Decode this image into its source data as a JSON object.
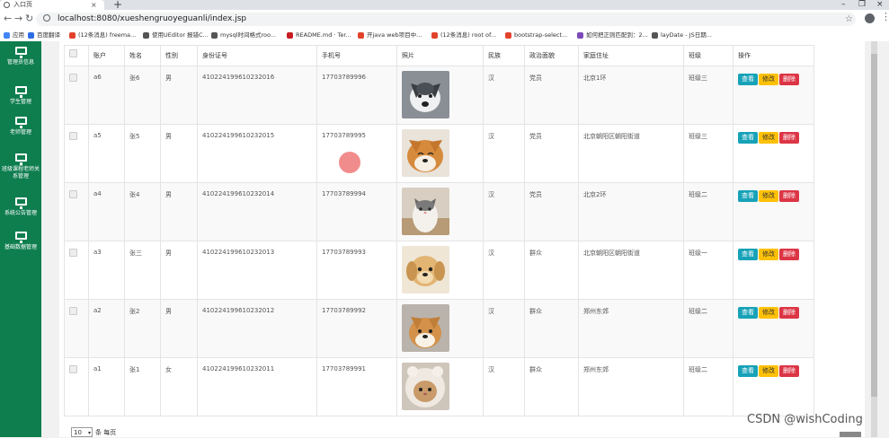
{
  "browser": {
    "tab_title": "入口页",
    "url": "localhost:8080/xueshengruoyeguanli/index.jsp",
    "bookmarks": [
      {
        "label": "应用",
        "color": "#4285f4"
      },
      {
        "label": "百度翻译",
        "color": "#2b6de5"
      },
      {
        "label": "(12条消息) freema...",
        "color": "#e2422b"
      },
      {
        "label": "使用UEditor 报错C...",
        "color": "#555555"
      },
      {
        "label": "mysql时间格式roo...",
        "color": "#555555"
      },
      {
        "label": "README.md · Ter...",
        "color": "#c71d23"
      },
      {
        "label": "开java web项目中...",
        "color": "#e2422b"
      },
      {
        "label": "(12条消息) root of...",
        "color": "#e2422b"
      },
      {
        "label": "bootstrap-select...",
        "color": "#e2422b"
      },
      {
        "label": "如何把正则匹配到：2...",
        "color": "#7b4ab8"
      },
      {
        "label": "layDate - JS日期...",
        "color": "#555555"
      }
    ]
  },
  "sidebar": {
    "items": [
      {
        "label": "管理员信息"
      },
      {
        "label": "学生管理"
      },
      {
        "label": "老师管理"
      },
      {
        "label": "班级课程老师关系管理"
      },
      {
        "label": "系统公告管理"
      },
      {
        "label": "基础数据管理"
      }
    ]
  },
  "table": {
    "headers": [
      "",
      "账户",
      "姓名",
      "性别",
      "身份证号",
      "手机号",
      "照片",
      "民族",
      "政治面貌",
      "家庭住址",
      "班级",
      "操作"
    ],
    "rows": [
      {
        "account": "a6",
        "name": "张6",
        "gender": "男",
        "id_no": "410224199610232016",
        "phone": "17703789996",
        "photo": "husky-dog",
        "ethnicity": "汉",
        "political": "党员",
        "address": "北京1环",
        "class": "班级三"
      },
      {
        "account": "a5",
        "name": "张5",
        "gender": "男",
        "id_no": "410224199610232015",
        "phone": "17703789995",
        "photo": "shiba-dog",
        "ethnicity": "汉",
        "political": "党员",
        "address": "北京朝阳区朝阳街道",
        "class": "班级三"
      },
      {
        "account": "a4",
        "name": "张4",
        "gender": "男",
        "id_no": "410224199610232014",
        "phone": "17703789994",
        "photo": "cat",
        "ethnicity": "汉",
        "political": "党员",
        "address": "北京2环",
        "class": "班级二"
      },
      {
        "account": "a3",
        "name": "张三",
        "gender": "男",
        "id_no": "410224199610232013",
        "phone": "17703789993",
        "photo": "puppy",
        "ethnicity": "汉",
        "political": "群众",
        "address": "北京朝阳区朝阳街道",
        "class": "班级一"
      },
      {
        "account": "a2",
        "name": "张2",
        "gender": "男",
        "id_no": "410224199610232012",
        "phone": "17703789992",
        "photo": "shiba-dog-2",
        "ethnicity": "汉",
        "political": "群众",
        "address": "郑州东郊",
        "class": "班级二"
      },
      {
        "account": "a1",
        "name": "张1",
        "gender": "女",
        "id_no": "410224199610232011",
        "phone": "17703789991",
        "photo": "hooded-cat",
        "ethnicity": "汉",
        "political": "群众",
        "address": "郑州东郊",
        "class": "班级二"
      }
    ],
    "actions": {
      "view": "查看",
      "edit": "修改",
      "delete": "删除"
    }
  },
  "pager": {
    "page_size": "10",
    "label": "条 每页"
  },
  "watermark": "CSDN @wishCoding",
  "colors": {
    "sidebar": "#0f7e4f",
    "view": "#17a2b8",
    "edit": "#ffc107",
    "delete": "#dc3545"
  }
}
